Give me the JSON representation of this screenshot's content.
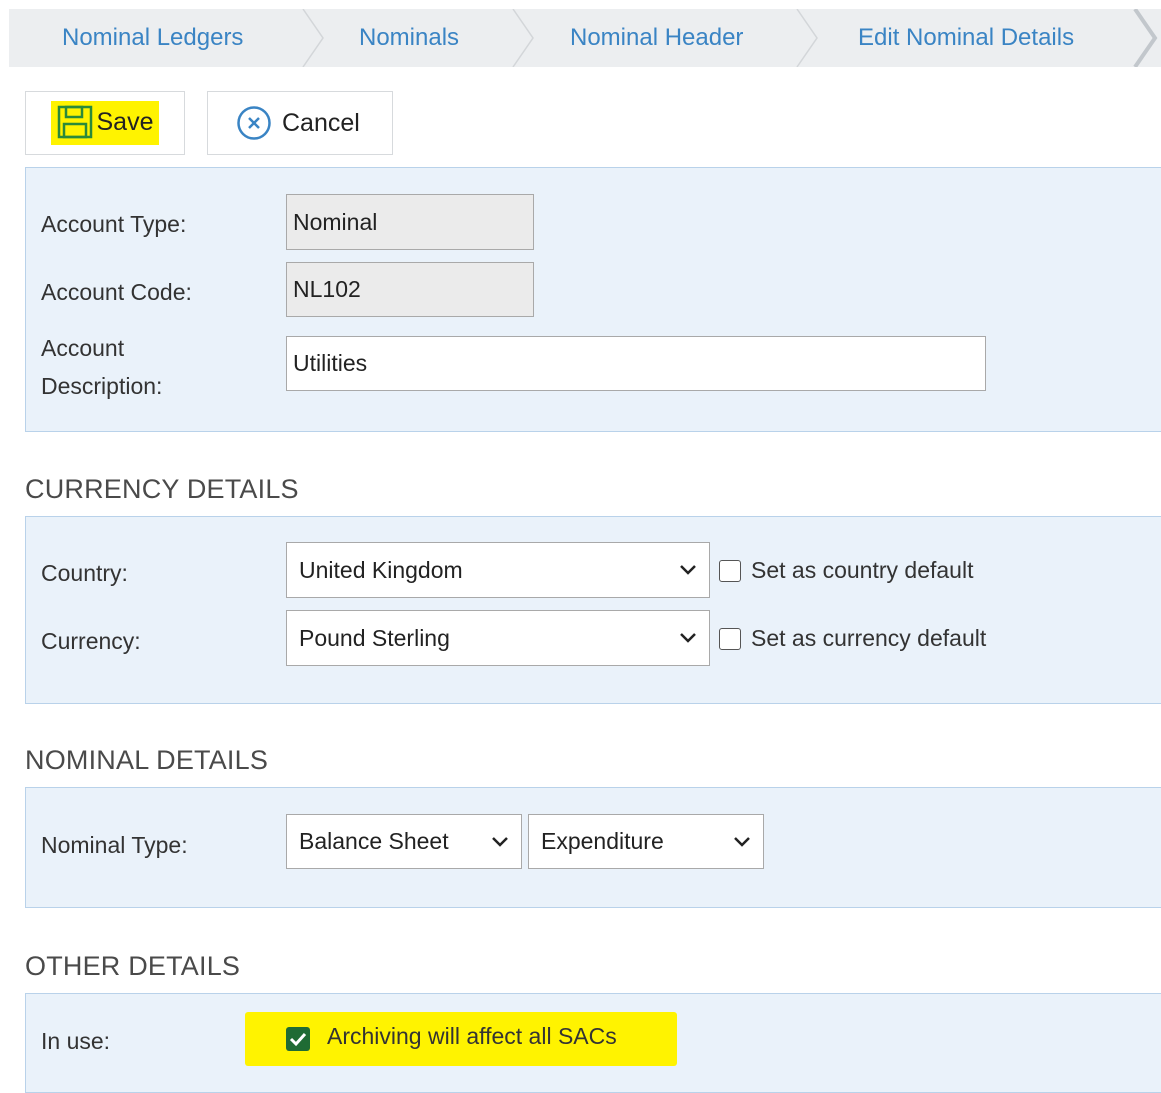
{
  "breadcrumb": {
    "items": [
      "Nominal Ledgers",
      "Nominals",
      "Nominal Header",
      "Edit Nominal Details"
    ]
  },
  "toolbar": {
    "save_label": "Save",
    "cancel_label": "Cancel"
  },
  "account": {
    "account_type_label": "Account Type:",
    "account_type_value": "Nominal",
    "account_code_label": "Account Code:",
    "account_code_value": "NL102",
    "account_description_label_1": "Account",
    "account_description_label_2": "Description:",
    "account_description_value": "Utilities"
  },
  "currency_details": {
    "title": "CURRENCY DETAILS",
    "country_label": "Country:",
    "country_value": "United Kingdom",
    "country_default_label": "Set as country default",
    "currency_label": "Currency:",
    "currency_value": "Pound Sterling",
    "currency_default_label": "Set as currency default"
  },
  "nominal_details": {
    "title": "NOMINAL DETAILS",
    "nominal_type_label": "Nominal Type:",
    "nominal_type_value_1": "Balance Sheet",
    "nominal_type_value_2": "Expenditure"
  },
  "other_details": {
    "title": "OTHER DETAILS",
    "in_use_label": "In use:",
    "archiving_label": "Archiving will affect all SACs",
    "archiving_checked": true
  },
  "colors": {
    "link": "#3a84c4",
    "panel_bg": "#eaf2fa",
    "panel_border": "#b9d2ea",
    "highlight": "#fff300",
    "checkbox_checked": "#1f6b34"
  },
  "icons": [
    "save-icon",
    "cancel-circle-x-icon",
    "chevron-down-icon",
    "checkmark-icon"
  ]
}
